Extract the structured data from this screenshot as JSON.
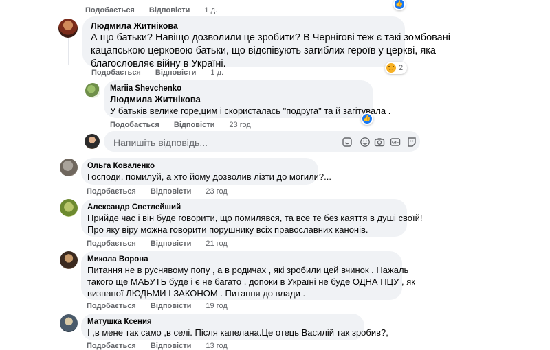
{
  "actions": {
    "like": "Подобається",
    "reply": "Відповісти"
  },
  "top_row": {
    "time": "1 д."
  },
  "comments": [
    {
      "author": "Людмила Житнікова",
      "lines": [
        "А що батьки? Навіщо дозволили це зробити? В Чернігові теж є такі зомбовані",
        "кацапською церковою батьки, що відспівують загиблих героїв у церкві, яка",
        "благословляє війну в Україні."
      ],
      "time": "1 д.",
      "reaction_count": "2"
    },
    {
      "author": "Mariia Shevchenko",
      "mention": "Людмила Житнікова",
      "lines": [
        "У батьків велике горе,цим і скористалась \"подруга\" та й загітувала ."
      ],
      "time": "23 год"
    },
    {
      "author": "Ольга Коваленко",
      "lines": [
        "Господи, помилуй, а хто йому дозволив лізти до могили?..."
      ],
      "time": "23 год"
    },
    {
      "author": "Александр Светлейший",
      "lines": [
        "Прийде час і він буде говорити, що помилявся, та все те без каяття в душі своїй!",
        "Про яку віру можна говорити порушнику всіх православних канонів."
      ],
      "time": "21 год"
    },
    {
      "author": "Микола Ворона",
      "lines": [
        "Питання не в руснявому попу , а в родичах , які зробили цей вчинок . Нажаль",
        "такого ще МАБУТЬ буде і є не багато , допоки в Україні не буде ОДНА ПЦУ , як",
        "визнаної ЛЮДЬМИ І ЗАКОНОМ . Питання до влади ."
      ],
      "time": "19 год"
    },
    {
      "author": "Матушка Ксения",
      "lines": [
        "І ,в мене так само ,в селі. Після капелана.Це отець Василій так зробив?,"
      ],
      "time": "13 год"
    }
  ],
  "reply_box": {
    "placeholder": "Напишіть відповідь..."
  },
  "icons": {
    "like_reaction": "thumbs-up-icon",
    "sad_reaction": "sad-face-icon",
    "sticker": "sticker-icon",
    "emoji": "emoji-icon",
    "camera": "camera-icon",
    "gif": "gif-icon",
    "avatar_sticker": "avatar-sticker-icon"
  },
  "colors": {
    "bubble": "#f0f2f5",
    "meta_text": "#65676b",
    "like_blue": "#1877f2",
    "sad_yellow": "#f7b125"
  }
}
